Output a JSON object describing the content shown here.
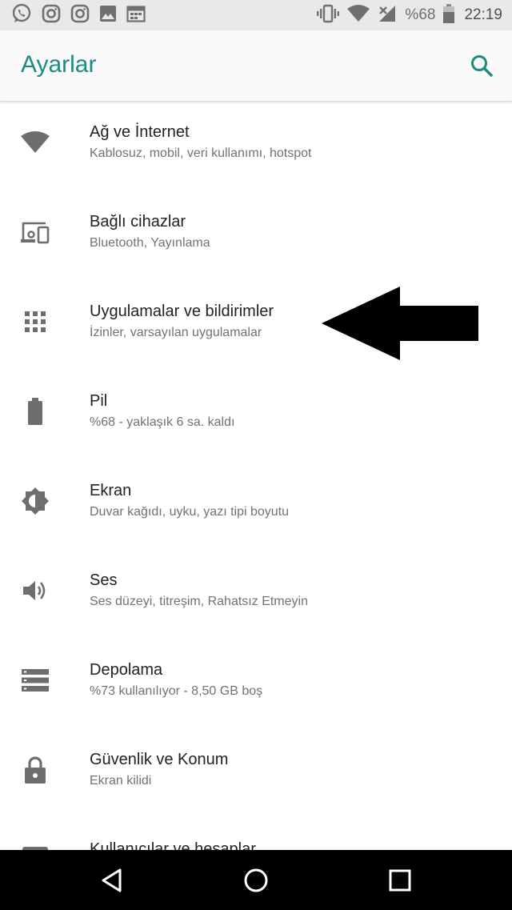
{
  "status_bar": {
    "battery": "%68",
    "time": "22:19",
    "icons": [
      "whatsapp-icon",
      "instagram-icon",
      "instagram-icon",
      "image-icon",
      "calendar-icon",
      "vibrate-icon",
      "wifi-icon",
      "no-signal-icon",
      "battery-icon"
    ]
  },
  "toolbar": {
    "title": "Ayarlar",
    "search_icon": "search-icon"
  },
  "settings": [
    {
      "title": "Ağ ve İnternet",
      "subtitle": "Kablosuz, mobil, veri kullanımı, hotspot",
      "icon": "wifi-icon"
    },
    {
      "title": "Bağlı cihazlar",
      "subtitle": "Bluetooth, Yayınlama",
      "icon": "connected-devices-icon"
    },
    {
      "title": "Uygulamalar ve bildirimler",
      "subtitle": "İzinler, varsayılan uygulamalar",
      "icon": "apps-grid-icon"
    },
    {
      "title": "Pil",
      "subtitle": "%68 - yaklaşık 6 sa. kaldı",
      "icon": "battery-icon"
    },
    {
      "title": "Ekran",
      "subtitle": "Duvar kağıdı, uyku, yazı tipi boyutu",
      "icon": "brightness-icon"
    },
    {
      "title": "Ses",
      "subtitle": "Ses düzeyi, titreşim, Rahatsız Etmeyin",
      "icon": "volume-icon"
    },
    {
      "title": "Depolama",
      "subtitle": "%73 kullanılıyor - 8,50 GB boş",
      "icon": "storage-icon"
    },
    {
      "title": "Güvenlik ve Konum",
      "subtitle": "Ekran kilidi",
      "icon": "lock-icon"
    },
    {
      "title": "Kullanıcılar ve hesaplar",
      "subtitle": "",
      "icon": "account-icon"
    }
  ],
  "annotation": {
    "icon": "pointer-arrow-icon",
    "color": "#000000"
  },
  "nav_bar": {
    "icons": [
      "back-icon",
      "home-icon",
      "recents-icon"
    ]
  },
  "colors": {
    "accent": "#1a8c80",
    "icon_gray": "#6e6e6e"
  }
}
